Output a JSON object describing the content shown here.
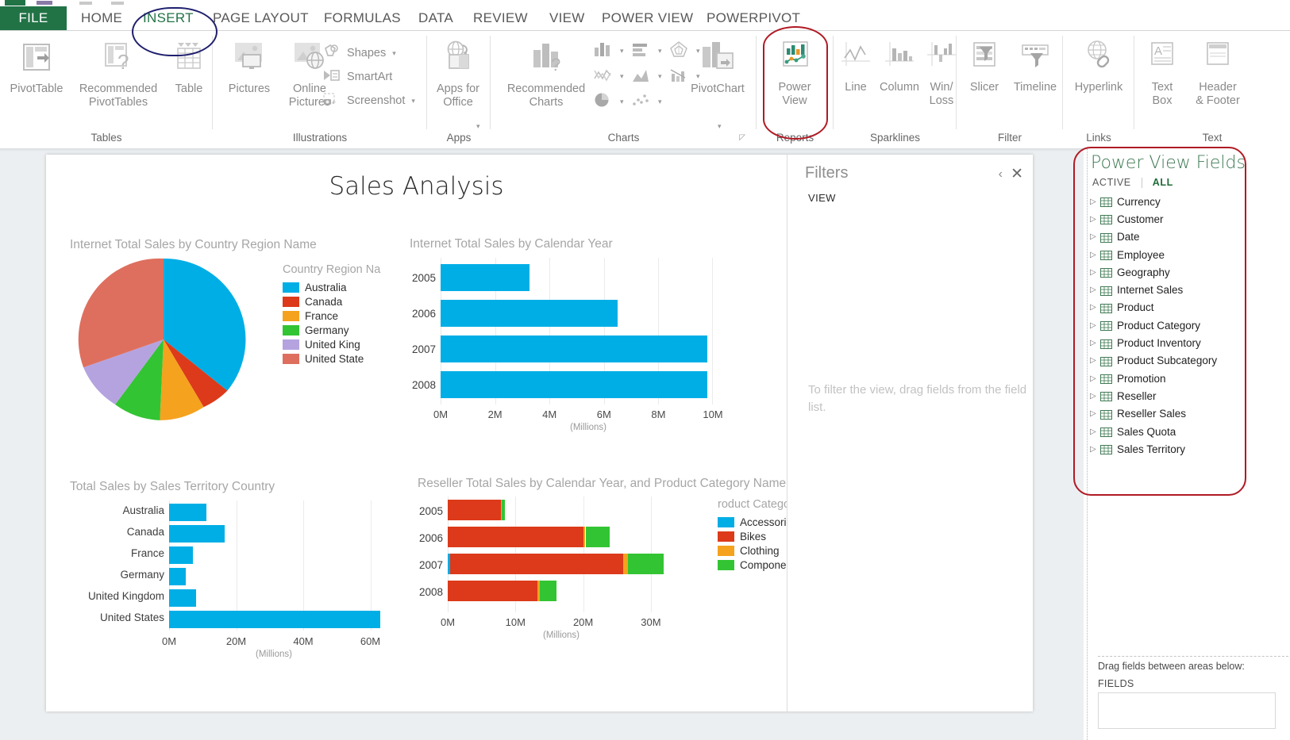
{
  "ribbon": {
    "tabs": [
      {
        "label": "FILE",
        "state": "file"
      },
      {
        "label": "HOME",
        "state": "normal"
      },
      {
        "label": "INSERT",
        "state": "active"
      },
      {
        "label": "PAGE LAYOUT",
        "state": "normal"
      },
      {
        "label": "FORMULAS",
        "state": "normal"
      },
      {
        "label": "DATA",
        "state": "normal"
      },
      {
        "label": "REVIEW",
        "state": "normal"
      },
      {
        "label": "VIEW",
        "state": "normal"
      },
      {
        "label": "POWER VIEW",
        "state": "normal"
      },
      {
        "label": "POWERPIVOT",
        "state": "normal"
      }
    ],
    "groups": {
      "tables": {
        "label": "Tables",
        "pivottable": "PivotTable",
        "recommended_pivottables_l1": "Recommended",
        "recommended_pivottables_l2": "PivotTables",
        "table": "Table"
      },
      "illustrations": {
        "label": "Illustrations",
        "pictures": "Pictures",
        "online_pictures_l1": "Online",
        "online_pictures_l2": "Pictures",
        "shapes": "Shapes",
        "smartart": "SmartArt",
        "screenshot": "Screenshot"
      },
      "apps": {
        "label": "Apps",
        "apps_for_office_l1": "Apps for",
        "apps_for_office_l2": "Office"
      },
      "charts": {
        "label": "Charts",
        "recommended_charts_l1": "Recommended",
        "recommended_charts_l2": "Charts",
        "pivotchart": "PivotChart"
      },
      "reports": {
        "label": "Reports",
        "power_view_l1": "Power",
        "power_view_l2": "View"
      },
      "sparklines": {
        "label": "Sparklines",
        "line": "Line",
        "column": "Column",
        "winloss_l1": "Win/",
        "winloss_l2": "Loss"
      },
      "filter": {
        "label": "Filter",
        "slicer": "Slicer",
        "timeline": "Timeline"
      },
      "links": {
        "label": "Links",
        "hyperlink": "Hyperlink"
      },
      "text": {
        "label": "Text",
        "textbox_l1": "Text",
        "textbox_l2": "Box",
        "header_footer_l1": "Header",
        "header_footer_l2": "& Footer"
      }
    }
  },
  "report": {
    "title": "Sales Analysis"
  },
  "filters": {
    "heading": "Filters",
    "section_label": "VIEW",
    "empty_hint": "To filter the view, drag fields from the field list.",
    "collapse_icon": "chevron-left-icon",
    "close_icon": "close-icon"
  },
  "fields_panel": {
    "title": "Power View Fields",
    "tab_active": "ACTIVE",
    "tab_all": "ALL",
    "tables": [
      "Currency",
      "Customer",
      "Date",
      "Employee",
      "Geography",
      "Internet Sales",
      "Product",
      "Product Category",
      "Product Inventory",
      "Product Subcategory",
      "Promotion",
      "Reseller",
      "Reseller Sales",
      "Sales Quota",
      "Sales Territory"
    ],
    "drag_hint": "Drag fields between areas below:",
    "fields_area_label": "FIELDS"
  },
  "colors": {
    "excel_green": "#217346",
    "accent_cyan": "#00AEE6",
    "accent_red": "#DC3A1A",
    "accent_orange": "#F5A21E",
    "accent_green": "#33C433",
    "accent_purple": "#B5A3E0",
    "accent_salmon": "#DE6F5E",
    "annotation_navy": "#1F1F6E",
    "annotation_red": "#B01A24"
  },
  "chart_data": [
    {
      "id": "pie-internet-sales-by-country",
      "type": "pie",
      "title": "Internet Total Sales by Country Region Name",
      "legend_title": "Country Region Na",
      "legend_position": "right",
      "categories": [
        "Australia",
        "Canada",
        "France",
        "Germany",
        "United King",
        "United State"
      ],
      "values": [
        35.5,
        7.5,
        9.7,
        7.8,
        10.3,
        29.2
      ],
      "colors": [
        "#00AEE6",
        "#DC3A1A",
        "#F5A21E",
        "#33C433",
        "#B5A3E0",
        "#DE6F5E"
      ]
    },
    {
      "id": "bar-internet-sales-by-year",
      "type": "bar",
      "title": "Internet Total Sales by Calendar Year",
      "categories": [
        "2005",
        "2006",
        "2007",
        "2008"
      ],
      "values": [
        3.25,
        6.5,
        9.8,
        9.8
      ],
      "tick_labels": [
        "0M",
        "2M",
        "4M",
        "6M",
        "8M",
        "10M"
      ],
      "ticks": [
        0,
        2,
        4,
        6,
        8,
        10
      ],
      "xlim": [
        0,
        10
      ],
      "xlabel": "(Millions)",
      "ylabel": "",
      "color": "#00AEE6",
      "grid": true
    },
    {
      "id": "bar-total-sales-by-territory",
      "type": "bar",
      "title": "Total Sales by Sales Territory Country",
      "categories": [
        "Australia",
        "Canada",
        "France",
        "Germany",
        "United Kingdom",
        "United States"
      ],
      "values": [
        11.0,
        16.5,
        7.0,
        5.0,
        8.0,
        63.0
      ],
      "tick_labels": [
        "0M",
        "20M",
        "40M",
        "60M"
      ],
      "ticks": [
        0,
        20,
        40,
        60
      ],
      "xlim": [
        0,
        68
      ],
      "xlabel": "(Millions)",
      "ylabel": "",
      "color": "#00AEE6",
      "grid": true
    },
    {
      "id": "stacked-reseller-sales-by-year-category",
      "type": "bar",
      "stacked": true,
      "title": "Reseller Total Sales by Calendar Year, and Product Category Name",
      "legend_title": "roduct Category Na",
      "legend_position": "right",
      "categories": [
        "2005",
        "2006",
        "2007",
        "2008"
      ],
      "series": [
        {
          "name": "Accessories",
          "color": "#00AEE6",
          "values": [
            0.0,
            0.0,
            0.35,
            0.0
          ]
        },
        {
          "name": "Bikes",
          "color": "#DC3A1A",
          "values": [
            7.9,
            20.1,
            25.6,
            13.3
          ]
        },
        {
          "name": "Clothing",
          "color": "#F5A21E",
          "values": [
            0.05,
            0.25,
            0.65,
            0.3
          ]
        },
        {
          "name": "Components",
          "color": "#33C433",
          "values": [
            0.55,
            3.6,
            5.3,
            2.4
          ]
        }
      ],
      "tick_labels": [
        "0M",
        "10M",
        "20M",
        "30M"
      ],
      "ticks": [
        0,
        10,
        20,
        30
      ],
      "xlim": [
        0,
        34
      ],
      "xlabel": "(Millions)",
      "grid": true
    }
  ]
}
